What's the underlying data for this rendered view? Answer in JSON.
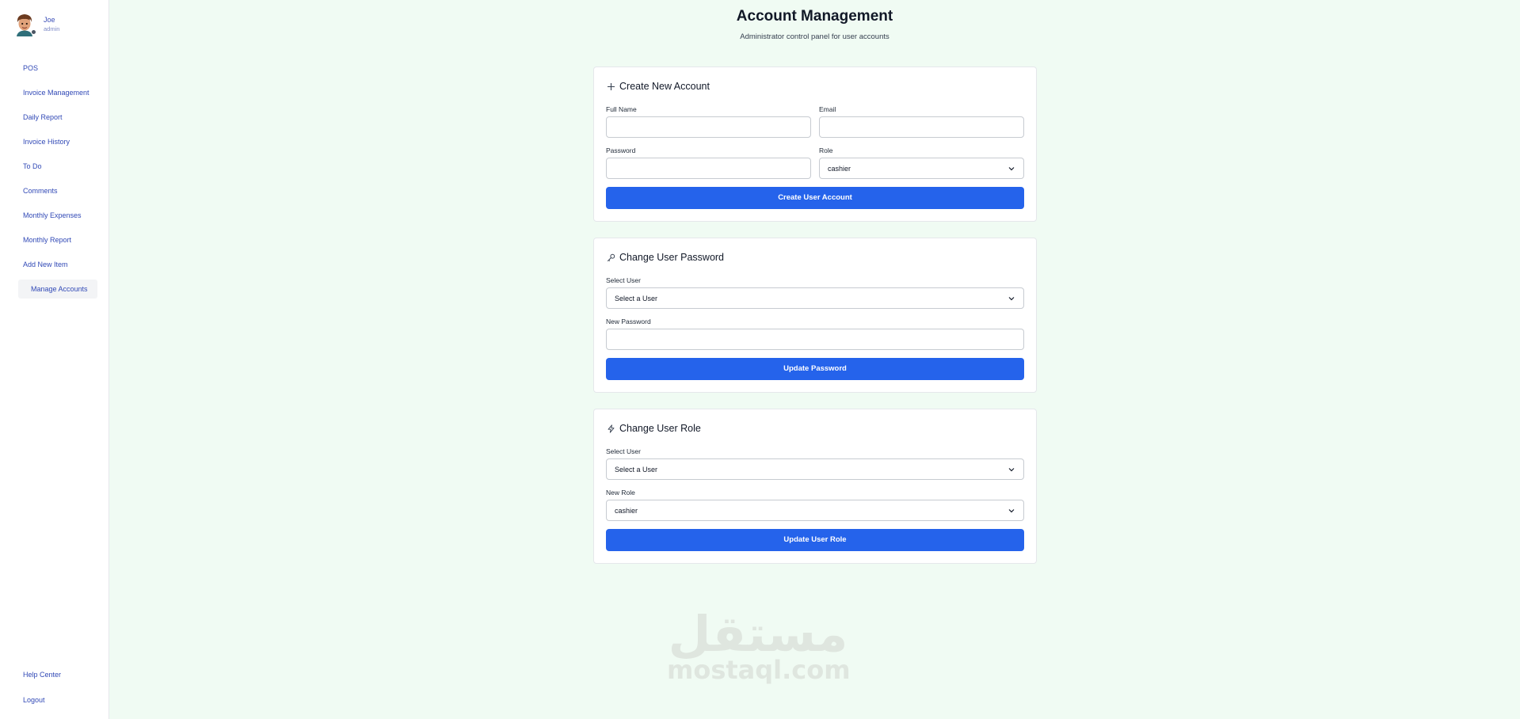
{
  "user": {
    "name": "Joe",
    "role": "admin"
  },
  "sidebar": {
    "items": [
      {
        "label": "POS"
      },
      {
        "label": "Invoice Management"
      },
      {
        "label": "Daily Report"
      },
      {
        "label": "Invoice History"
      },
      {
        "label": "To Do"
      },
      {
        "label": "Comments"
      },
      {
        "label": "Monthly Expenses"
      },
      {
        "label": "Monthly Report"
      },
      {
        "label": "Add New Item"
      },
      {
        "label": "Manage Accounts",
        "active": true
      }
    ],
    "bottom": [
      {
        "label": "Help Center"
      },
      {
        "label": "Logout"
      }
    ]
  },
  "header": {
    "title": "Account Management",
    "subtitle": "Administrator control panel for user accounts"
  },
  "create_account": {
    "title": "Create New Account",
    "icon": "plus-icon",
    "full_name_label": "Full Name",
    "full_name_value": "",
    "email_label": "Email",
    "email_value": "",
    "password_label": "Password",
    "password_value": "",
    "role_label": "Role",
    "role_value": "cashier",
    "submit_label": "Create User Account"
  },
  "change_password": {
    "title": "Change User Password",
    "icon": "key-icon",
    "select_user_label": "Select User",
    "select_user_value": "Select a User",
    "new_password_label": "New Password",
    "new_password_value": "",
    "submit_label": "Update Password"
  },
  "change_role": {
    "title": "Change User Role",
    "icon": "bolt-icon",
    "select_user_label": "Select User",
    "select_user_value": "Select a User",
    "new_role_label": "New Role",
    "new_role_value": "cashier",
    "submit_label": "Update User Role"
  },
  "watermark": {
    "arabic": "مستقل",
    "latin": "mostaql.com"
  },
  "colors": {
    "primary": "#2563eb",
    "background": "#f0fbf3",
    "nav_link": "#3149b6"
  }
}
